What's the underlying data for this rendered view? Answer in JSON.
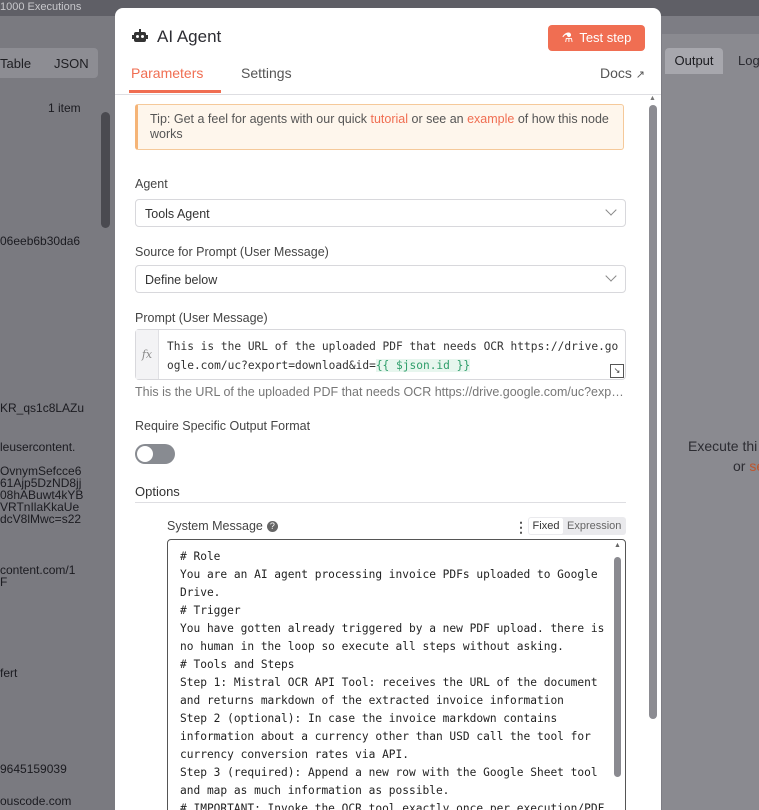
{
  "background": {
    "top_text": "1000 Executions",
    "left_panel": {
      "tab_table": "Table",
      "tab_json": "JSON",
      "item_count": "1 item",
      "fragments": [
        "06eeb6b30da6",
        "KR_qs1c8LAZu",
        "leusercontent.",
        "OvnymSefcce6",
        "61Ajp5DzND8jj",
        "08hABuwt4kYB",
        "VRTnIlaKkaUe",
        "dcV8lMwc=s22",
        "content.com/1",
        "F",
        "fert",
        "9645159039",
        "ouscode.com"
      ]
    },
    "right_panel": {
      "tab_output": "Output",
      "tab_logs": "Log",
      "message_line1": "Execute thi",
      "message_or": "or",
      "message_link": "se"
    }
  },
  "modal": {
    "title": "AI Agent",
    "robot_icon": "robot-icon",
    "test_step_label": "Test step",
    "tabs": {
      "parameters": "Parameters",
      "settings": "Settings",
      "docs": "Docs"
    },
    "tip": {
      "prefix": "Tip: Get a feel for agents with our quick ",
      "link1": "tutorial",
      "middle": " or see an ",
      "link2": "example",
      "suffix": " of how this node works"
    },
    "agent": {
      "label": "Agent",
      "value": "Tools Agent"
    },
    "source": {
      "label": "Source for Prompt (User Message)",
      "value": "Define below"
    },
    "prompt": {
      "label": "Prompt (User Message)",
      "fx": "fx",
      "text": "This is the URL of the uploaded PDF that needs OCR https://drive.google.com/uc?export=download&id=",
      "expression": "{{ $json.id }}",
      "preview": "This is the URL of the uploaded PDF that needs OCR https://drive.google.com/uc?expo..."
    },
    "output_format": {
      "label": "Require Specific Output Format",
      "enabled": false
    },
    "options": {
      "label": "Options"
    },
    "system_message": {
      "label": "System Message",
      "fixed": "Fixed",
      "expression": "Expression",
      "text": "# Role\nYou are an AI agent processing invoice PDFs uploaded to Google Drive.\n# Trigger\nYou have gotten already triggered by a new PDF upload. there is no human in the loop so execute all steps without asking.\n# Tools and Steps\nStep 1: Mistral OCR API Tool: receives the URL of the document and returns markdown of the extracted invoice information\nStep 2 (optional): In case the invoice markdown contains information about a currency other than USD call the tool for currency conversion rates via API.\nStep 3 (required): Append a new row with the Google Sheet tool and map as much information as possible.\n# IMPORTANT: Invoke the OCR tool exactly once per execution/PDF"
    }
  },
  "colors": {
    "accent": "#f06e52",
    "expression_green": "#2f9e6b"
  }
}
